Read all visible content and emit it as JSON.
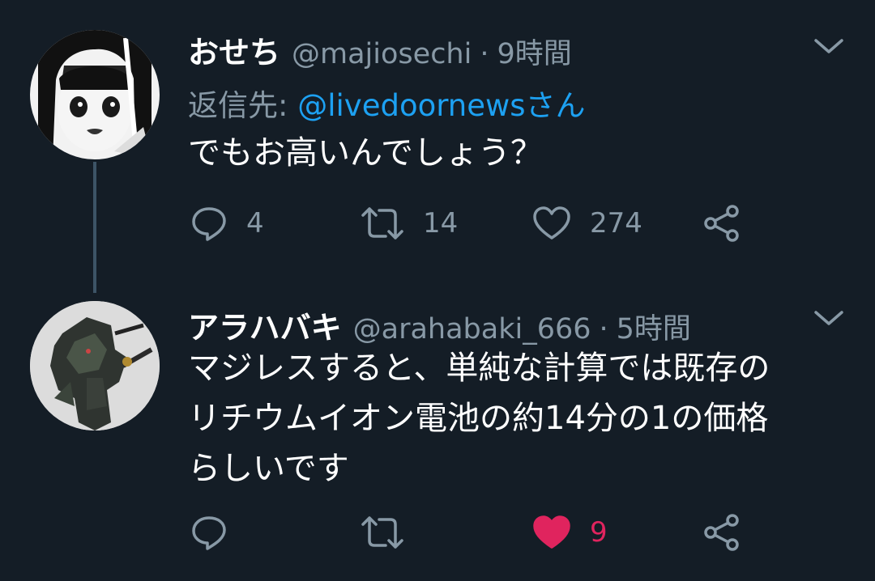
{
  "tweets": [
    {
      "name": "おせち",
      "handle": "@majiosechi",
      "separator": "·",
      "time": "9時間",
      "reply_label": "返信先: ",
      "reply_mention": "@livedoornewsさん",
      "text": "でもお高いんでしょう？",
      "counts": {
        "reply": "4",
        "retweet": "14",
        "like": "274"
      },
      "liked": false
    },
    {
      "name": "アラハバキ",
      "handle": "@arahabaki_666",
      "separator": "·",
      "time": "5時間",
      "text_lines": [
        "マジレスすると、単純な計算では既存の",
        "リチウムイオン電池の約14分の1の価格",
        "らしいです"
      ],
      "counts": {
        "reply": "",
        "retweet": "",
        "like": "9"
      },
      "liked": true
    }
  ],
  "colors": {
    "background": "#141d26",
    "secondary": "#8899a6",
    "link": "#1da1f2",
    "like_active": "#e0245e"
  },
  "icons": [
    "reply-icon",
    "retweet-icon",
    "like-icon",
    "share-icon",
    "chevron-down-icon"
  ]
}
